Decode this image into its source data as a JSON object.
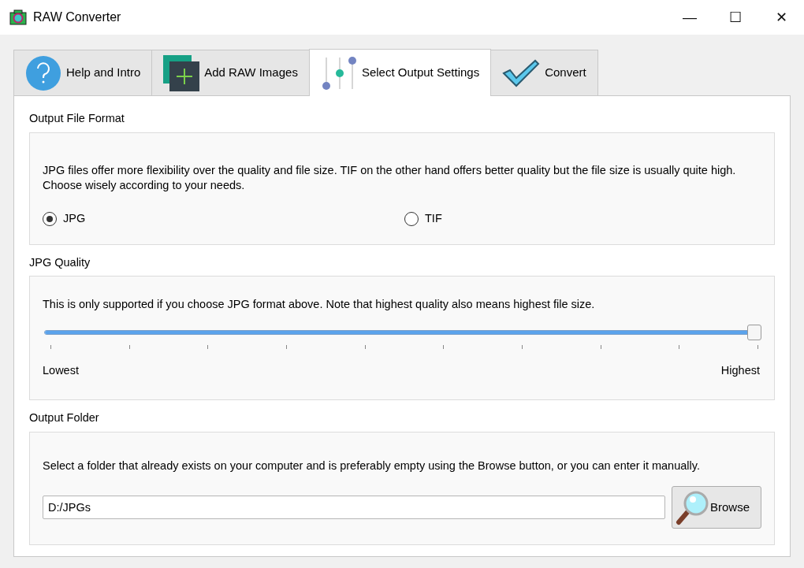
{
  "window": {
    "title": "RAW Converter",
    "controls": [
      "—",
      "☐",
      "✕"
    ]
  },
  "tabs": [
    {
      "kind": "help",
      "label": "Help and Intro",
      "selected": false
    },
    {
      "kind": "add",
      "label": "Add RAW Images",
      "selected": false
    },
    {
      "kind": "settings",
      "label": "Select Output Settings",
      "selected": true
    },
    {
      "kind": "convert",
      "label": "Convert",
      "selected": false
    }
  ],
  "output_format": {
    "title": "Output File Format",
    "description": "JPG files offer more flexibility over the quality and file size. TIF on the other hand offers better quality but the file size is usually quite high. Choose wisely according to your needs.",
    "options": [
      {
        "label": "JPG",
        "selected": true
      },
      {
        "label": "TIF",
        "selected": false
      }
    ]
  },
  "jpg_quality": {
    "title": "JPG Quality",
    "description": "This is only supported if you choose JPG format above. Note that highest quality also means highest file size.",
    "level": 1.0,
    "min_label": "Lowest",
    "max_label": "Highest"
  },
  "output_folder": {
    "title": "Output Folder",
    "description": "Select a folder that already exists on your computer and is preferably empty using the Browse button, or you can enter it manually.",
    "value": "D:/JPGs",
    "button": "Browse"
  }
}
